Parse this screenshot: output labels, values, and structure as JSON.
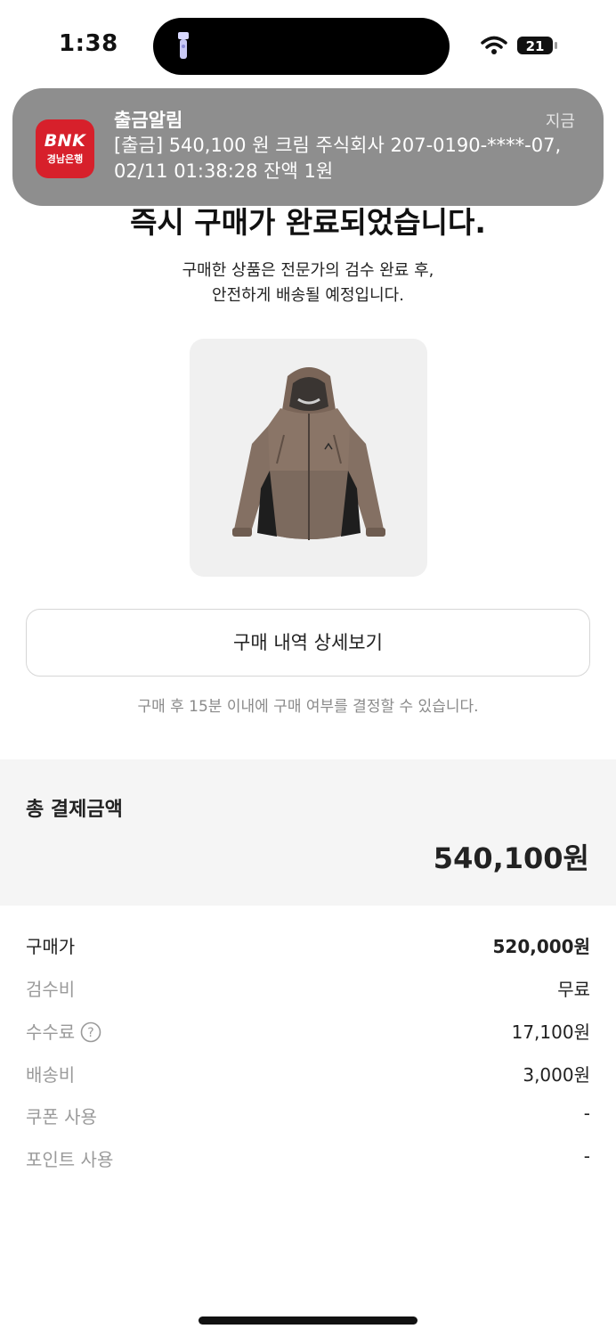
{
  "status_bar": {
    "time": "1:38",
    "battery": "21"
  },
  "notification": {
    "app_icon_text": "BNK",
    "app_icon_subtext": "경남은행",
    "title": "출금알림",
    "time": "지금",
    "body": "[출금] 540,100 원 크림 주식회사 207-0190-****-07, 02/11 01:38:28 잔액 1원"
  },
  "main": {
    "headline": "즉시 구매가 완료되었습니다.",
    "subtext_line1": "구매한 상품은 전문가의 검수 완료 후,",
    "subtext_line2": "안전하게 배송될 예정입니다.",
    "detail_button": "구매 내역 상세보기",
    "hint": "구매 후 15분 이내에 구매 여부를 결정할 수 있습니다."
  },
  "total": {
    "label": "총 결제금액",
    "amount": "540,100원"
  },
  "breakdown": [
    {
      "label": "구매가",
      "value": "520,000원"
    },
    {
      "label": "검수비",
      "value": "무료"
    },
    {
      "label": "수수료",
      "value": "17,100원"
    },
    {
      "label": "배송비",
      "value": "3,000원"
    },
    {
      "label": "쿠폰 사용",
      "value": "-"
    },
    {
      "label": "포인트 사용",
      "value": "-"
    }
  ],
  "colors": {
    "bank_red": "#d7202b",
    "notification_bg": "#8e8e8e",
    "total_bg": "#f5f5f5"
  }
}
